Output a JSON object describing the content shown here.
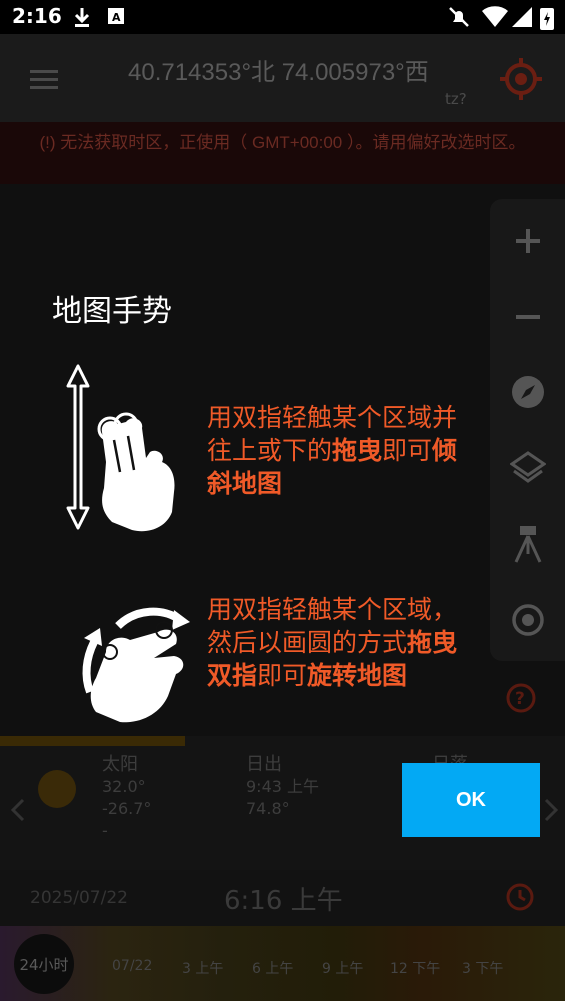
{
  "status_bar": {
    "time": "2:16",
    "icons": [
      "download-icon",
      "a-keyboard-icon",
      "mute-bell-icon",
      "wifi-icon",
      "signal-icon",
      "battery-charging-icon"
    ]
  },
  "header": {
    "coordinates": "40.714353°北  74.005973°西",
    "tz_hint": "tz?"
  },
  "warning": {
    "text": "(!) 无法获取时区，正使用（ GMT+00:00 ）。请用偏好改选时区。"
  },
  "toolbar": {
    "items": [
      "zoom-in-icon",
      "zoom-out-icon",
      "compass-icon",
      "layers-icon",
      "tripod-icon",
      "target-icon"
    ]
  },
  "bottom": {
    "sun": {
      "title": "太阳",
      "alt": "32.0°",
      "az": "-26.7°",
      "extra": "-"
    },
    "sunrise": {
      "title": "日出",
      "time": "9:43 上午",
      "az": "74.8°"
    },
    "sunset": {
      "title": "日落"
    },
    "date": "2025/07/22",
    "current_time": "6:16 上午",
    "timeline_badge": "24小时",
    "timeline_labels": [
      "07/22",
      "3 上午",
      "6 上午",
      "9 上午",
      "12 下午",
      "3 下午"
    ]
  },
  "overlay": {
    "title": "地图手势",
    "tilt": {
      "line1": "用双指轻触某个区域并",
      "line2_a": "往上或下的",
      "line2_b": "拖曳",
      "line2_c": "即可",
      "line2_d": "倾",
      "line3": "斜地图"
    },
    "rotate": {
      "line1": "用双指轻触某个区域，",
      "line2_a": "然后以画圆的方式",
      "line2_b": "拖曳",
      "line3_a": "双指",
      "line3_b": "即可",
      "line3_c": "旋转地图"
    },
    "ok_label": "OK"
  },
  "colors": {
    "accent": "#f05a28",
    "ok_button": "#03a9f4"
  }
}
